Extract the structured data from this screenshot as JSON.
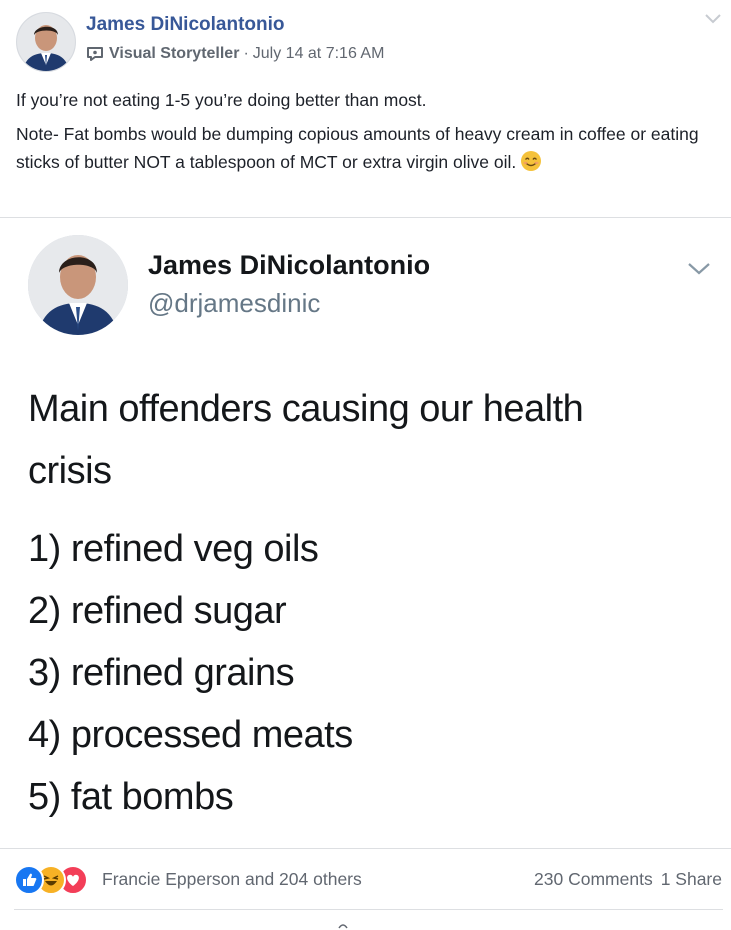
{
  "post": {
    "author": "James DiNicolantonio",
    "badge_icon": "visual-storyteller-badge-icon",
    "badge": "Visual Storyteller",
    "separator": "·",
    "timestamp": "July 14 at 7:16 AM",
    "text_line1": "If you’re not eating 1-5 you’re doing better than most.",
    "text_line2": "Note- Fat bombs would be dumping copious amounts of heavy cream in coffee or eating sticks of butter NOT a tablespoon of MCT or extra virgin olive oil.",
    "emoji": "smiling-face-icon"
  },
  "tweet": {
    "name": "James DiNicolantonio",
    "handle": "@drjamesdinic",
    "lines": [
      "Main offenders causing our health",
      "crisis"
    ],
    "items": [
      "1) refined veg oils",
      "2) refined sugar",
      "3) refined grains",
      "4) processed meats",
      "5) fat bombs"
    ]
  },
  "footer": {
    "reaction_icons": [
      "like-icon",
      "haha-icon",
      "love-icon"
    ],
    "reactors": "Francie Epperson and 204 others",
    "comments": "230 Comments",
    "shares": "1 Share"
  },
  "colors": {
    "link_blue": "#385898",
    "meta_gray": "#616770",
    "like_blue": "#1877f2",
    "haha_yellow": "#f7b125",
    "love_red": "#f33e58"
  }
}
